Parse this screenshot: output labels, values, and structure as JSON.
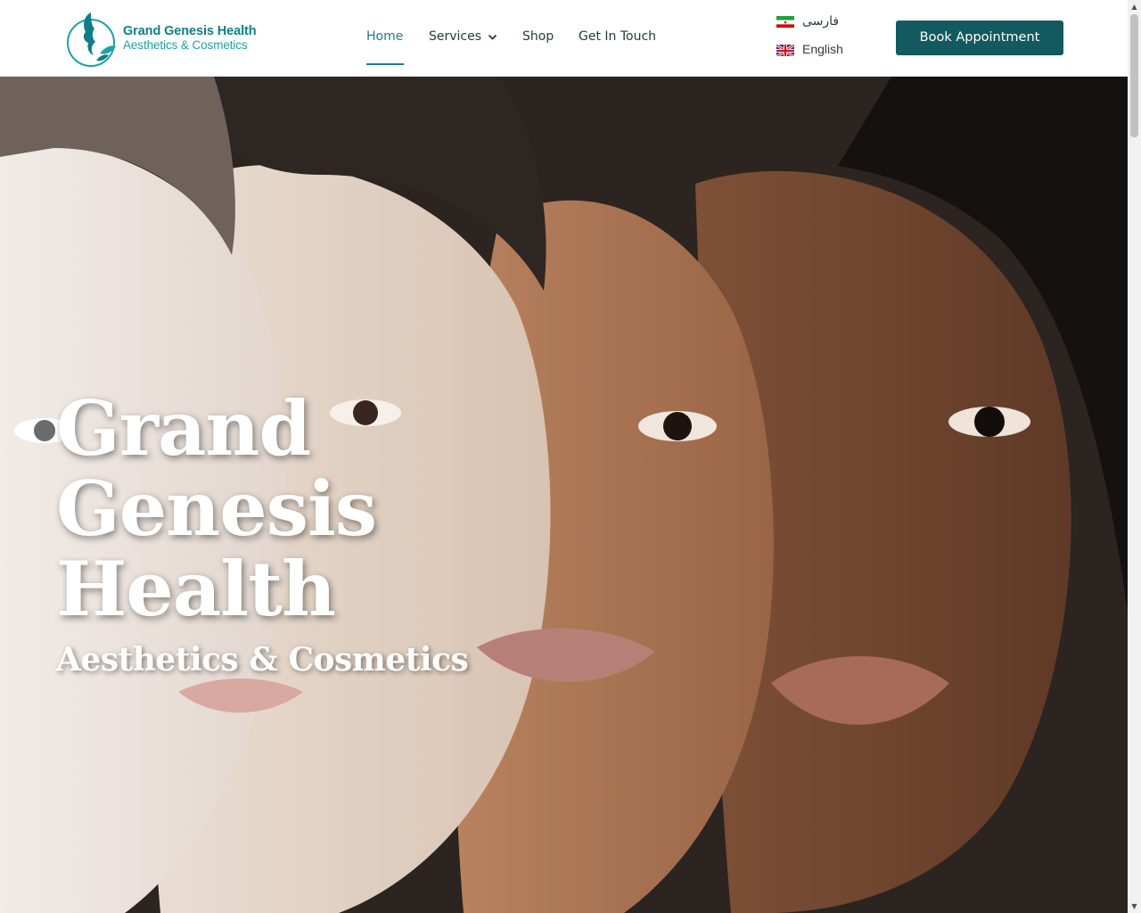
{
  "logo": {
    "line1": "Grand Genesis Health",
    "line2": "Aesthetics & Cosmetics",
    "color_primary": "#0f7f86",
    "color_secondary": "#1aa3a6"
  },
  "nav": {
    "items": [
      {
        "label": "Home",
        "active": true
      },
      {
        "label": "Services",
        "has_dropdown": true
      },
      {
        "label": "Shop"
      },
      {
        "label": "Get In Touch"
      }
    ],
    "active_color": "#1e7b85"
  },
  "languages": [
    {
      "label": "فارسی",
      "flag": "iran-flag-icon"
    },
    {
      "label": "English",
      "flag": "uk-flag-icon"
    }
  ],
  "cta": {
    "label": "Book Appointment",
    "color": "#135a60"
  },
  "hero": {
    "title_lines": [
      "Grand",
      "Genesis",
      "Health"
    ],
    "subtitle": "Aesthetics & Cosmetics"
  }
}
